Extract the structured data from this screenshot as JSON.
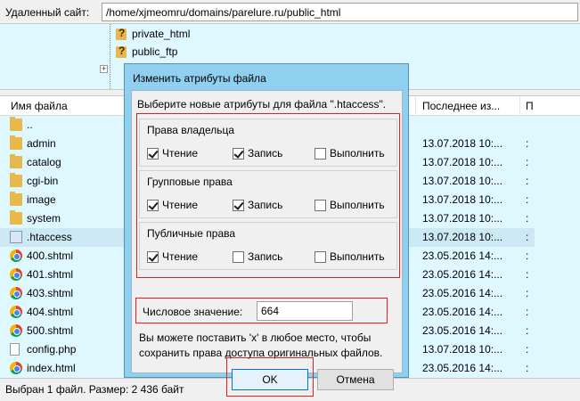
{
  "remote": {
    "label": "Удаленный сайт:",
    "path": "/home/xjmeomru/domains/parelure.ru/public_html"
  },
  "tree": {
    "items": [
      "private_html",
      "public_ftp"
    ]
  },
  "list": {
    "headers": {
      "name": "Имя файла",
      "date": "Последнее из...",
      "perm": "П"
    },
    "rows": [
      {
        "name": "..",
        "date": "",
        "perm": "",
        "icon": "folder-icon"
      },
      {
        "name": "admin",
        "date": "13.07.2018 10:...",
        "perm": ":",
        "icon": "folder-icon"
      },
      {
        "name": "catalog",
        "date": "13.07.2018 10:...",
        "perm": ":",
        "icon": "folder-icon"
      },
      {
        "name": "cgi-bin",
        "date": "13.07.2018 10:...",
        "perm": ":",
        "icon": "folder-icon"
      },
      {
        "name": "image",
        "date": "13.07.2018 10:...",
        "perm": ":",
        "icon": "folder-icon"
      },
      {
        "name": "system",
        "date": "13.07.2018 10:...",
        "perm": ":",
        "icon": "folder-icon"
      },
      {
        "name": ".htaccess",
        "date": "13.07.2018 10:...",
        "perm": ":",
        "icon": "htaccess-file-icon"
      },
      {
        "name": "400.shtml",
        "date": "23.05.2016 14:...",
        "perm": ":",
        "icon": "chrome-icon"
      },
      {
        "name": "401.shtml",
        "date": "23.05.2016 14:...",
        "perm": ":",
        "icon": "chrome-icon"
      },
      {
        "name": "403.shtml",
        "date": "23.05.2016 14:...",
        "perm": ":",
        "icon": "chrome-icon"
      },
      {
        "name": "404.shtml",
        "date": "23.05.2016 14:...",
        "perm": ":",
        "icon": "chrome-icon"
      },
      {
        "name": "500.shtml",
        "date": "23.05.2016 14:...",
        "perm": ":",
        "icon": "chrome-icon"
      },
      {
        "name": "config.php",
        "date": "13.07.2018 10:...",
        "perm": ":",
        "icon": "file-icon"
      },
      {
        "name": "index.html",
        "date": "23.05.2016 14:...",
        "perm": ":",
        "icon": "chrome-icon"
      }
    ]
  },
  "status": "Выбран 1 файл. Размер: 2 436 байт",
  "dialog": {
    "title": "Изменить атрибуты файла",
    "prompt": "Выберите новые атрибуты для файла \".htaccess\".",
    "groups": [
      {
        "title": "Права владельца",
        "read": true,
        "write": true,
        "exec": false
      },
      {
        "title": "Групповые права",
        "read": true,
        "write": true,
        "exec": false
      },
      {
        "title": "Публичные права",
        "read": true,
        "write": false,
        "exec": false
      }
    ],
    "labels": {
      "read": "Чтение",
      "write": "Запись",
      "exec": "Выполнить"
    },
    "numeric_label": "Числовое значение:",
    "numeric_value": "664",
    "hint": "Вы можете поставить 'x' в любое место, чтобы сохранить права доступа оригинальных файлов.",
    "ok": "OK",
    "cancel": "Отмена"
  },
  "colors": {
    "highlight": "#e02020",
    "pane_bg": "#dff7ff",
    "title_bg": "#8fcff0"
  }
}
